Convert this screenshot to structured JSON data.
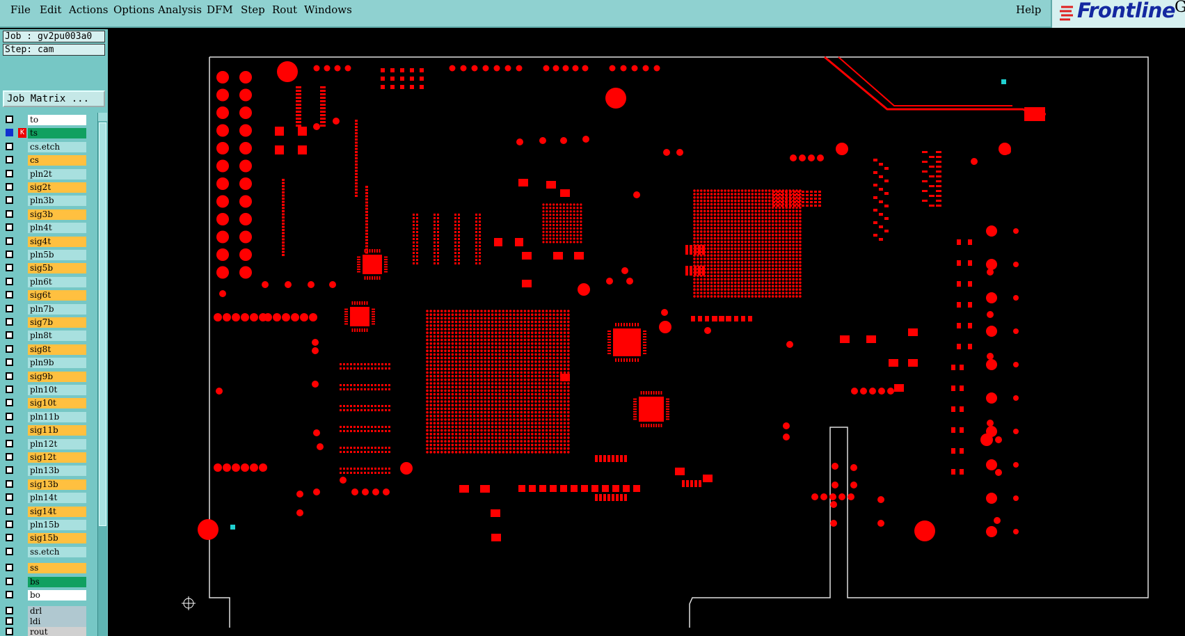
{
  "menu": {
    "items": [
      "File",
      "Edit",
      "Actions",
      "Options",
      "Analysis",
      "DFM",
      "Step",
      "Rout",
      "Windows"
    ],
    "help": "Help"
  },
  "brand": {
    "name": "Frontline",
    "suffix": "Ge"
  },
  "job": {
    "label": "Job : gv2pu003a0",
    "step": "Step: cam",
    "matrix_button": "Job Matrix ..."
  },
  "layers": [
    {
      "name": "to",
      "color": "#ffffff"
    },
    {
      "name": "ts",
      "color": "#10a060",
      "selected": true,
      "cursor": "K"
    },
    {
      "name": "cs.etch",
      "color": "#a8e0df"
    },
    {
      "name": "cs",
      "color": "#ffc040"
    },
    {
      "name": "pln2t",
      "color": "#a8e0df"
    },
    {
      "name": "sig2t",
      "color": "#ffc040"
    },
    {
      "name": "pln3b",
      "color": "#a8e0df"
    },
    {
      "name": "sig3b",
      "color": "#ffc040"
    },
    {
      "name": "pln4t",
      "color": "#a8e0df"
    },
    {
      "name": "sig4t",
      "color": "#ffc040"
    },
    {
      "name": "pln5b",
      "color": "#a8e0df"
    },
    {
      "name": "sig5b",
      "color": "#ffc040"
    },
    {
      "name": "pln6t",
      "color": "#a8e0df"
    },
    {
      "name": "sig6t",
      "color": "#ffc040"
    },
    {
      "name": "pln7b",
      "color": "#a8e0df"
    },
    {
      "name": "sig7b",
      "color": "#ffc040"
    },
    {
      "name": "pln8t",
      "color": "#a8e0df"
    },
    {
      "name": "sig8t",
      "color": "#ffc040"
    },
    {
      "name": "pln9b",
      "color": "#a8e0df"
    },
    {
      "name": "sig9b",
      "color": "#ffc040"
    },
    {
      "name": "pln10t",
      "color": "#a8e0df"
    },
    {
      "name": "sig10t",
      "color": "#ffc040"
    },
    {
      "name": "pln11b",
      "color": "#a8e0df"
    },
    {
      "name": "sig11b",
      "color": "#ffc040"
    },
    {
      "name": "pln12t",
      "color": "#a8e0df"
    },
    {
      "name": "sig12t",
      "color": "#ffc040"
    },
    {
      "name": "pln13b",
      "color": "#a8e0df"
    },
    {
      "name": "sig13b",
      "color": "#ffc040"
    },
    {
      "name": "pln14t",
      "color": "#a8e0df"
    },
    {
      "name": "sig14t",
      "color": "#ffc040"
    },
    {
      "name": "pln15b",
      "color": "#a8e0df"
    },
    {
      "name": "sig15b",
      "color": "#ffc040"
    },
    {
      "name": "ss.etch",
      "color": "#a8e0df"
    },
    {
      "name": "ss",
      "color": "#ffc040"
    },
    {
      "name": "bs",
      "color": "#10a060"
    },
    {
      "name": "bo",
      "color": "#ffffff"
    },
    {
      "name": "drl",
      "color": "#b0c8d0"
    },
    {
      "name": "ldi",
      "color": "#b0c8d0"
    },
    {
      "name": "rout",
      "color": "#d0d0d0"
    }
  ],
  "colors": {
    "copper": "#ff0000",
    "outline": "#e0e0e0",
    "marker": "#20d0d0",
    "canvas": "#000000"
  }
}
